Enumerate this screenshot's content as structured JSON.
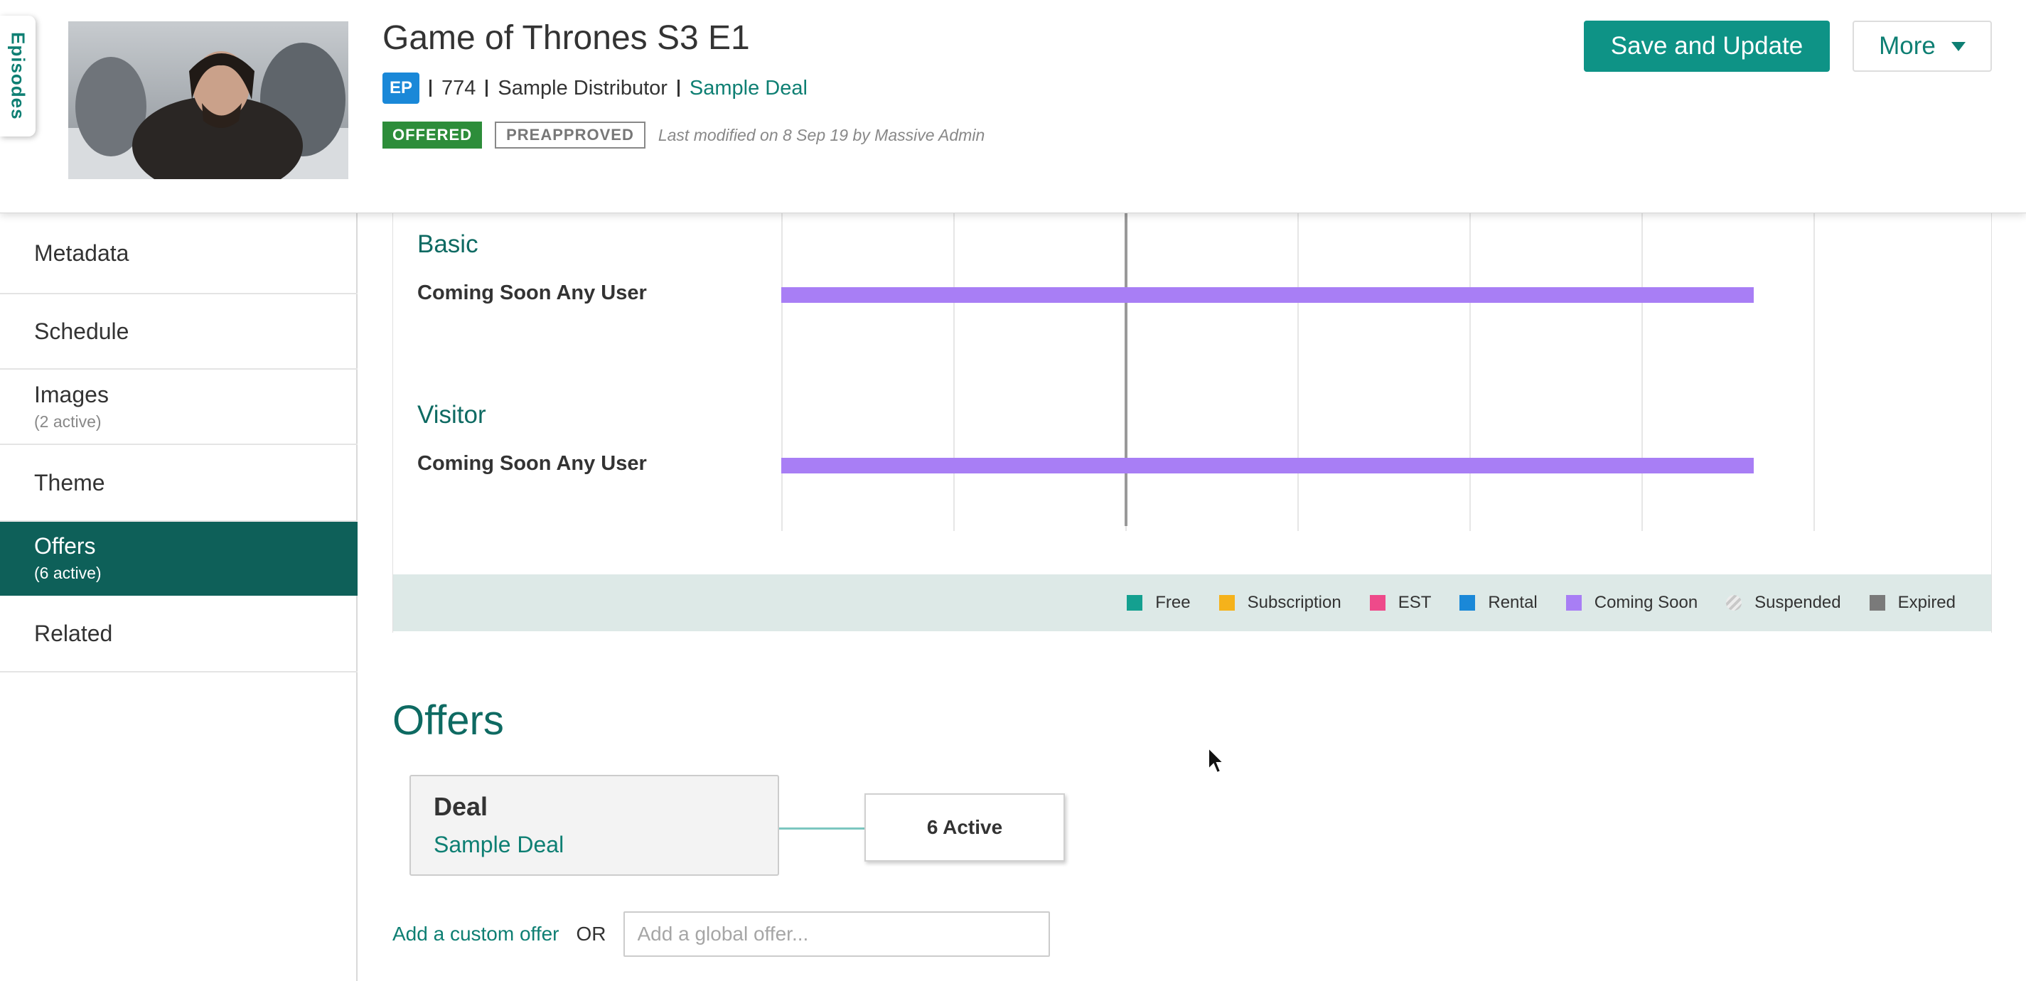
{
  "header": {
    "episodes_tab": "Episodes",
    "title": "Game of Thrones S3 E1",
    "type_badge": "EP",
    "id": "774",
    "distributor": "Sample Distributor",
    "deal_link": "Sample Deal",
    "status_offered": "OFFERED",
    "status_preapproved": "PREAPPROVED",
    "last_modified": "Last modified on 8 Sep 19 by Massive Admin",
    "save_button": "Save and Update",
    "more_button": "More"
  },
  "sidebar": {
    "items": [
      {
        "label": "Metadata",
        "sub": ""
      },
      {
        "label": "Schedule",
        "sub": ""
      },
      {
        "label": "Images",
        "sub": "(2 active)"
      },
      {
        "label": "Theme",
        "sub": ""
      },
      {
        "label": "Offers",
        "sub": "(6 active)"
      },
      {
        "label": "Related",
        "sub": ""
      }
    ],
    "active_index": 4
  },
  "timeline": {
    "groups": [
      {
        "title": "Basic",
        "row": "Coming Soon Any User",
        "bar_type": "Coming Soon"
      },
      {
        "title": "Visitor",
        "row": "Coming Soon Any User",
        "bar_type": "Coming Soon"
      }
    ],
    "legend": [
      {
        "label": "Free",
        "color": "#14a090"
      },
      {
        "label": "Subscription",
        "color": "#f5b21b"
      },
      {
        "label": "EST",
        "color": "#ee4a8a"
      },
      {
        "label": "Rental",
        "color": "#1a88d8"
      },
      {
        "label": "Coming Soon",
        "color": "#a87ef5"
      },
      {
        "label": "Suspended",
        "color": "striped-grey"
      },
      {
        "label": "Expired",
        "color": "#7a7a7a"
      }
    ]
  },
  "offers": {
    "title": "Offers",
    "deal_title": "Deal",
    "deal_link": "Sample Deal",
    "active_count": "6 Active",
    "add_custom": "Add a custom offer",
    "or": "OR",
    "global_placeholder": "Add a global offer..."
  },
  "colors": {
    "accent": "#0e7f73",
    "primary_button": "#0e9386",
    "sidebar_active": "#0e6059",
    "offered": "#2d8d3a",
    "coming_soon": "#a87ef5"
  }
}
